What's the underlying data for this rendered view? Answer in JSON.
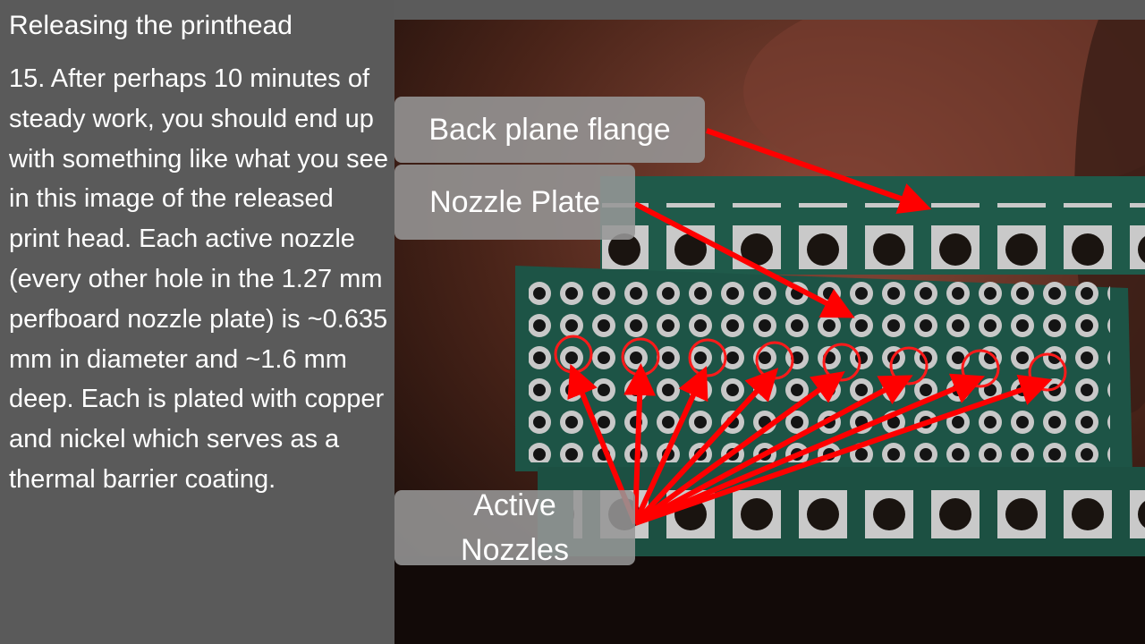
{
  "slide": {
    "title": "Releasing the printhead",
    "body": "15. After perhaps 10 minutes of steady work, you should end up with something like what you see in this image of the released print head. Each active nozzle (every other hole in the 1.27 mm perfboard nozzle plate) is ~0.635 mm in diameter and ~1.6 mm deep.  Each is plated with copper and nickel which serves as a thermal barrier coating."
  },
  "callouts": {
    "back_plane_flange": "Back plane flange",
    "nozzle_plate": "Nozzle Plate",
    "active_nozzles": "Active\nNozzles"
  },
  "colors": {
    "background": "#5a5a5a",
    "text": "#ffffff",
    "callout_bg": "#969696",
    "arrow": "#ff0000",
    "board_green": "#1f5a4a"
  },
  "photo": {
    "subject": "released print head perfboard",
    "icon": "photo-image"
  }
}
